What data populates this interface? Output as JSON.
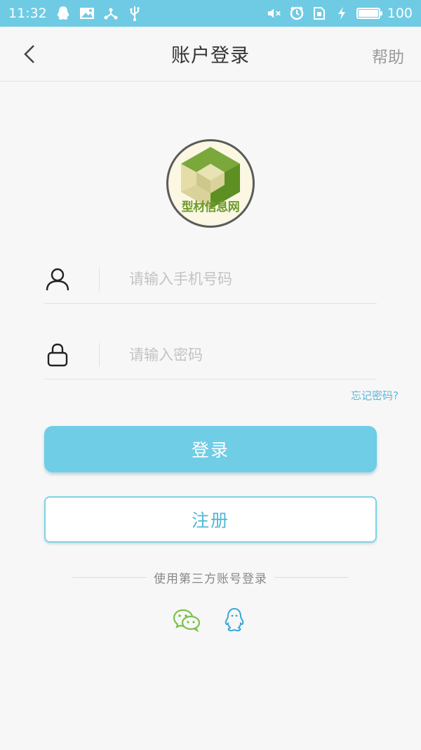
{
  "status_bar": {
    "time": "11:32",
    "battery_level": "100",
    "icons": [
      "qq-icon",
      "image-notification-icon",
      "share-icon",
      "usb-icon",
      "mute-icon",
      "alarm-icon",
      "sim-icon",
      "charging-icon",
      "battery-icon"
    ],
    "color": "#6fcbe4"
  },
  "nav": {
    "title": "账户登录",
    "help_label": "帮助",
    "back_icon": "chevron-left-icon"
  },
  "logo": {
    "text": "型材信息网",
    "colors": {
      "green": "#6c9a2c",
      "light": "#d9d29a"
    }
  },
  "form": {
    "phone": {
      "placeholder": "请输入手机号码",
      "value": "",
      "icon": "user-icon"
    },
    "password": {
      "placeholder": "请输入密码",
      "value": "",
      "icon": "lock-icon"
    },
    "forgot_label": "忘记密码?"
  },
  "buttons": {
    "login_label": "登录",
    "register_label": "注册",
    "accent": "#6fcde6"
  },
  "third_party": {
    "label": "使用第三方账号登录",
    "providers": [
      {
        "name": "wechat",
        "icon": "wechat-icon",
        "color": "#7cc24a"
      },
      {
        "name": "qq",
        "icon": "qq-icon",
        "color": "#3aa6d8"
      }
    ]
  }
}
